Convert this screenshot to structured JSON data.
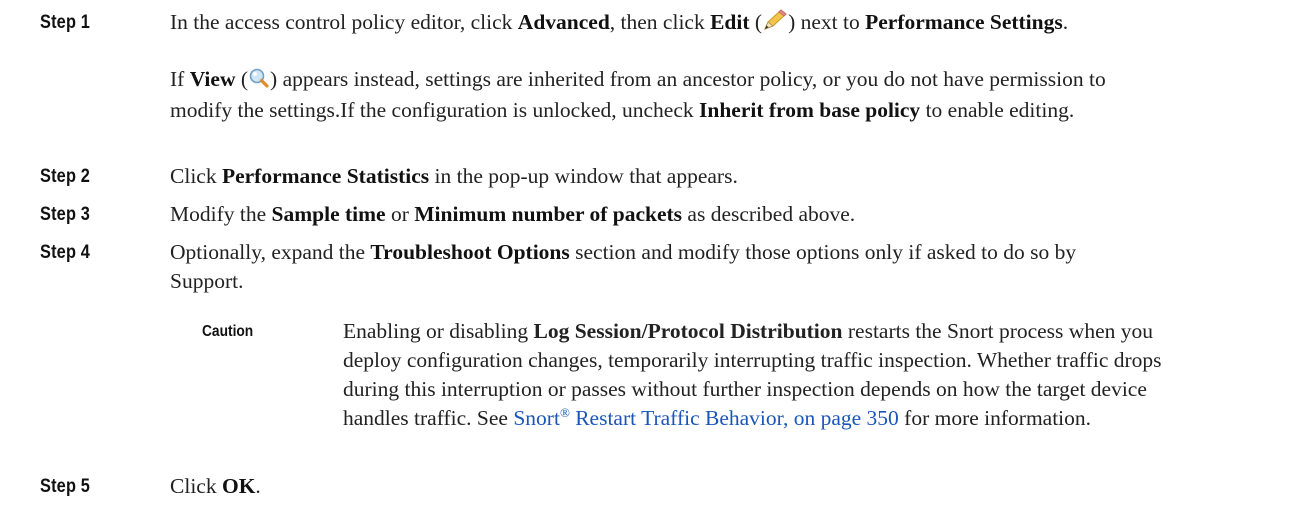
{
  "steps": [
    {
      "label": "Step 1"
    },
    {
      "label": "Step 2"
    },
    {
      "label": "Step 3"
    },
    {
      "label": "Step 4"
    },
    {
      "label": "Step 5"
    }
  ],
  "step1": {
    "t1": "In the access control policy editor, click ",
    "b1": "Advanced",
    "t2": ", then click ",
    "b2": "Edit",
    "t3": " (",
    "t4": ") next to ",
    "b3": "Performance Settings",
    "t5": ".",
    "p2_t1": "If ",
    "p2_b1": "View",
    "p2_t2": " (",
    "p2_t3": ") appears instead, settings are inherited from an ancestor policy, or you do not have permission to",
    "p2_l2_t1": "modify the settings.If the configuration is unlocked, uncheck ",
    "p2_l2_b1": "Inherit from base policy",
    "p2_l2_t2": " to enable editing."
  },
  "step2": {
    "t1": "Click ",
    "b1": "Performance Statistics",
    "t2": " in the pop-up window that appears."
  },
  "step3": {
    "t1": "Modify the ",
    "b1": "Sample time",
    "t2": " or ",
    "b2": "Minimum number of packets",
    "t3": " as described above."
  },
  "step4": {
    "l1_t1": "Optionally, expand the ",
    "l1_b1": "Troubleshoot Options",
    "l1_t2": " section and modify those options only if asked to do so by",
    "l2": "Support."
  },
  "caution": {
    "label": "Caution",
    "l1_t1": "Enabling or disabling ",
    "l1_b1": "Log Session/Protocol Distribution",
    "l1_t2": "  restarts the Snort process when you",
    "l2": "deploy configuration changes, temporarily interrupting traffic inspection. Whether traffic drops",
    "l3": "during this interruption or passes without further inspection depends on how the target device",
    "l4_t1": "handles traffic. See ",
    "link_a": "Snort",
    "link_reg": "®",
    "link_b": " Restart Traffic Behavior, on page 350",
    "l4_t2": " for more information."
  },
  "step5": {
    "t1": "Click ",
    "b1": "OK",
    "t2": "."
  },
  "icons": {
    "edit": "pencil-icon",
    "view": "magnifier-icon"
  },
  "colors": {
    "link": "#1a56b8",
    "text": "#222222"
  }
}
